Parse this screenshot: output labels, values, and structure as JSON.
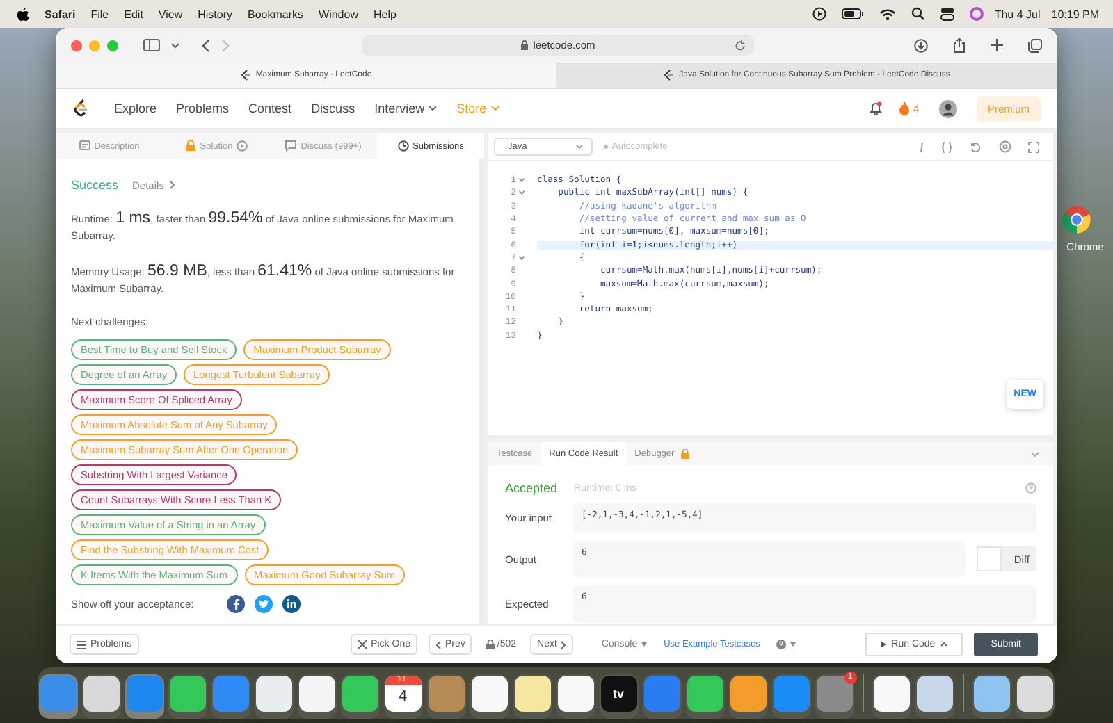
{
  "menubar": {
    "app": "Safari",
    "menus": [
      "File",
      "Edit",
      "View",
      "History",
      "Bookmarks",
      "Window",
      "Help"
    ],
    "date": "Thu 4 Jul",
    "time": "10:19 PM"
  },
  "desktop_icons": [
    {
      "label": "Chrome"
    }
  ],
  "browser": {
    "url": "leetcode.com",
    "tabs": [
      {
        "title": "Maximum Subarray - LeetCode",
        "selected": true
      },
      {
        "title": "Java Solution for Continuous Subarray Sum Problem - LeetCode Discuss",
        "selected": false
      }
    ]
  },
  "nav": {
    "items": [
      {
        "label": "Explore",
        "dropdown": false,
        "accent": false
      },
      {
        "label": "Problems",
        "dropdown": false,
        "accent": false
      },
      {
        "label": "Contest",
        "dropdown": false,
        "accent": false
      },
      {
        "label": "Discuss",
        "dropdown": false,
        "accent": false
      },
      {
        "label": "Interview",
        "dropdown": true,
        "accent": false
      },
      {
        "label": "Store",
        "dropdown": true,
        "accent": true
      }
    ],
    "streak": "4",
    "premium": "Premium"
  },
  "left_tabs": [
    {
      "label": "Description",
      "selected": false,
      "play": false
    },
    {
      "label": "Solution",
      "selected": false,
      "play": true
    },
    {
      "label": "Discuss (999+)",
      "selected": false,
      "play": false
    },
    {
      "label": "Submissions",
      "selected": true,
      "play": false
    }
  ],
  "result": {
    "status": "Success",
    "details": "Details",
    "runtime": {
      "label": "Runtime:",
      "value": "1 ms",
      "mid": ", faster than",
      "percent": "99.54%",
      "tail": "of Java online submissions for Maximum Subarray."
    },
    "memory": {
      "label": "Memory Usage:",
      "value": "56.9 MB",
      "mid": ", less than",
      "percent": "61.41%",
      "tail": "of Java online submissions for Maximum Subarray."
    }
  },
  "next_challenges": {
    "label": "Next challenges:",
    "items": [
      {
        "title": "Best Time to Buy and Sell Stock",
        "color": "#5cb27a"
      },
      {
        "title": "Maximum Product Subarray",
        "color": "#f0a030"
      },
      {
        "title": "Degree of an Array",
        "color": "#5cb27a"
      },
      {
        "title": "Longest Turbulent Subarray",
        "color": "#f0a030"
      },
      {
        "title": "Maximum Score Of Spliced Array",
        "color": "#b23a73"
      },
      {
        "title": "Maximum Absolute Sum of Any Subarray",
        "color": "#f0a030"
      },
      {
        "title": "Maximum Subarray Sum After One Operation",
        "color": "#f0a030"
      },
      {
        "title": "Substring With Largest Variance",
        "color": "#b23a73"
      },
      {
        "title": "Count Subarrays With Score Less Than K",
        "color": "#b23a73"
      },
      {
        "title": "Maximum Value of a String in an Array",
        "color": "#5cb27a"
      },
      {
        "title": "Find the Substring With Maximum Cost",
        "color": "#f0a030"
      },
      {
        "title": "K Items With the Maximum Sum",
        "color": "#5cb27a"
      },
      {
        "title": "Maximum Good Subarray Sum",
        "color": "#f0a030"
      }
    ]
  },
  "share": {
    "label": "Show off your acceptance:"
  },
  "problem_nav": {
    "problems": "Problems",
    "pick_one": "Pick One",
    "prev": "Prev",
    "count": "/502",
    "next": "Next"
  },
  "editor": {
    "language": "Java",
    "autocomplete": "Autocomplete",
    "new_badge": "NEW",
    "lines": [
      {
        "number": "1",
        "text": "class Solution {",
        "fold": true,
        "kind": "code",
        "current": false
      },
      {
        "number": "2",
        "text": "    public int maxSubArray(int[] nums) {",
        "fold": true,
        "kind": "code",
        "current": false
      },
      {
        "number": "3",
        "text": "        //using kadane's algorithm",
        "fold": false,
        "kind": "comment",
        "current": false
      },
      {
        "number": "4",
        "text": "        //setting value of current and max sum as 0",
        "fold": false,
        "kind": "comment",
        "current": false
      },
      {
        "number": "5",
        "text": "        int currsum=nums[0], maxsum=nums[0];",
        "fold": false,
        "kind": "code",
        "current": false
      },
      {
        "number": "6",
        "text": "        for(int i=1;i<nums.length;i++)",
        "fold": false,
        "kind": "code",
        "current": true
      },
      {
        "number": "7",
        "text": "        {",
        "fold": true,
        "kind": "code",
        "current": false
      },
      {
        "number": "8",
        "text": "            currsum=Math.max(nums[i],nums[i]+currsum);",
        "fold": false,
        "kind": "code",
        "current": false
      },
      {
        "number": "9",
        "text": "            maxsum=Math.max(currsum,maxsum);",
        "fold": false,
        "kind": "code",
        "current": false
      },
      {
        "number": "10",
        "text": "        }",
        "fold": false,
        "kind": "code",
        "current": false
      },
      {
        "number": "11",
        "text": "        return maxsum;",
        "fold": false,
        "kind": "code",
        "current": false
      },
      {
        "number": "12",
        "text": "    }",
        "fold": false,
        "kind": "code",
        "current": false
      },
      {
        "number": "13",
        "text": "}",
        "fold": false,
        "kind": "code",
        "current": false
      }
    ]
  },
  "console": {
    "tabs": [
      {
        "label": "Testcase",
        "selected": false,
        "locked": false
      },
      {
        "label": "Run Code Result",
        "selected": true,
        "locked": false
      },
      {
        "label": "Debugger",
        "selected": false,
        "locked": true
      }
    ],
    "status": "Accepted",
    "runtime": "Runtime: 0 ms",
    "diff": "Diff",
    "diff_checked": false,
    "rows": [
      {
        "label": "Your input",
        "value": "[-2,1,-3,4,-1,2,1,-5,4]",
        "kind": "input"
      },
      {
        "label": "Output",
        "value": "6",
        "kind": "output"
      },
      {
        "label": "Expected",
        "value": "6",
        "kind": "expected"
      }
    ]
  },
  "console_bar": {
    "console": "Console",
    "example": "Use Example Testcases",
    "run": "Run Code",
    "submit": "Submit"
  },
  "dock": [
    {
      "kind": "app",
      "color": "#3b8ee8",
      "running": true
    },
    {
      "kind": "app",
      "color": "#d9d9d9",
      "running": false
    },
    {
      "kind": "app",
      "color": "#1e88f0",
      "running": true
    },
    {
      "kind": "app",
      "color": "#34c759",
      "running": false
    },
    {
      "kind": "app",
      "color": "#2f8af5",
      "running": false
    },
    {
      "kind": "app",
      "color": "#e8eef0",
      "running": false
    },
    {
      "kind": "app",
      "color": "#f4f4f4",
      "running": false
    },
    {
      "kind": "app",
      "color": "#34c759",
      "running": false
    },
    {
      "kind": "calendar",
      "month": "JUL",
      "day": "4",
      "running": false
    },
    {
      "kind": "app",
      "color": "#b58a55",
      "running": false
    },
    {
      "kind": "app",
      "color": "#f8f8f8",
      "running": false
    },
    {
      "kind": "app",
      "color": "#f5e6a0",
      "running": false
    },
    {
      "kind": "app",
      "color": "#f8f8f8",
      "running": false
    },
    {
      "kind": "tv",
      "label": "tv",
      "running": false
    },
    {
      "kind": "app",
      "color": "#2a7df0",
      "running": false
    },
    {
      "kind": "app",
      "color": "#34c759",
      "running": false
    },
    {
      "kind": "app",
      "color": "#f39c2c",
      "running": false
    },
    {
      "kind": "app",
      "color": "#1a8cf5",
      "running": false
    },
    {
      "kind": "badge",
      "color": "#8a8a8a",
      "badge": "1",
      "running": false
    },
    {
      "kind": "separator"
    },
    {
      "kind": "app",
      "color": "#f8f8f8",
      "running": false
    },
    {
      "kind": "app",
      "color": "#c8d8ea",
      "running": false
    },
    {
      "kind": "separator"
    },
    {
      "kind": "app",
      "color": "#8fc3f0",
      "running": false
    },
    {
      "kind": "app",
      "color": "#dcdcdc",
      "running": false
    }
  ]
}
